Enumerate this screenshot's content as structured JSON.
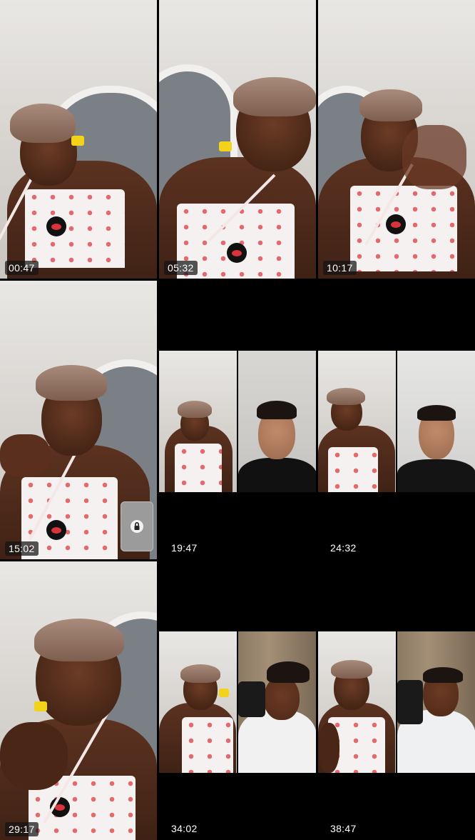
{
  "grid": {
    "cells": [
      {
        "timestamp": "00:47"
      },
      {
        "timestamp": "05:32"
      },
      {
        "timestamp": "10:17"
      },
      {
        "timestamp": "15:02"
      },
      {
        "timestamp": "19:47"
      },
      {
        "timestamp": "24:32"
      },
      {
        "timestamp": "29:17"
      },
      {
        "timestamp": "34:02"
      },
      {
        "timestamp": "38:47"
      }
    ]
  },
  "icons": {
    "overlay_button": "lock-icon"
  }
}
